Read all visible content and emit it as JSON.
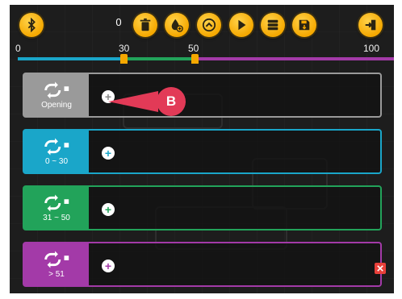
{
  "toolbar": {
    "counter": "0",
    "buttons": [
      {
        "name": "bluetooth-button",
        "icon": "bluetooth-icon"
      },
      {
        "name": "delete-button",
        "icon": "trash-icon"
      },
      {
        "name": "add-sound-button",
        "icon": "drop-plus-icon"
      },
      {
        "name": "up-button",
        "icon": "chevron-up-icon"
      },
      {
        "name": "play-button",
        "icon": "play-icon"
      },
      {
        "name": "stack-button",
        "icon": "stack-icon"
      },
      {
        "name": "save-button",
        "icon": "save-icon"
      },
      {
        "name": "exit-button",
        "icon": "exit-icon"
      }
    ]
  },
  "scale": {
    "ticks": [
      "0",
      "30",
      "50",
      "100"
    ],
    "marker_values": [
      30,
      50
    ],
    "colors": {
      "first": "#1aa6c9",
      "second": "#22a35a",
      "third": "#a33aa8"
    }
  },
  "slots": [
    {
      "label": "Opening",
      "color": "#9a9a9a",
      "add_color": "#8a8a8a"
    },
    {
      "label": "0 ~ 30",
      "color": "#1aa6c9",
      "add_color": "#1aa6c9"
    },
    {
      "label": "31 ~ 50",
      "color": "#22a35a",
      "add_color": "#22a35a"
    },
    {
      "label": "> 51",
      "color": "#a33aa8",
      "add_color": "#a33aa8"
    }
  ],
  "callout": {
    "text": "B",
    "color": "#e23a57"
  },
  "delete_icon": "close-icon"
}
